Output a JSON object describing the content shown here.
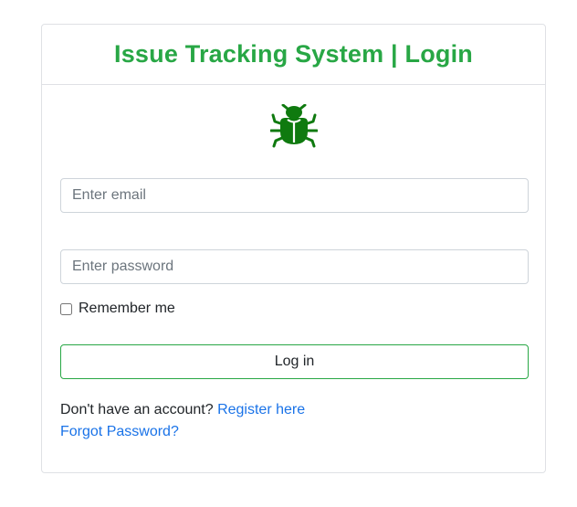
{
  "header": {
    "title": "Issue Tracking System | Login"
  },
  "logo": {
    "icon": "bug-icon",
    "color": "#0f7a0f"
  },
  "form": {
    "email_placeholder": "Enter email",
    "password_placeholder": "Enter password",
    "remember_label": "Remember me",
    "remember_checked": false,
    "login_label": "Log in"
  },
  "footer": {
    "register_prompt": "Don't have an account?",
    "register_link": "Register here",
    "forgot_link": "Forgot Password?"
  },
  "colors": {
    "accent": "#28a745",
    "link": "#1a73e8"
  }
}
